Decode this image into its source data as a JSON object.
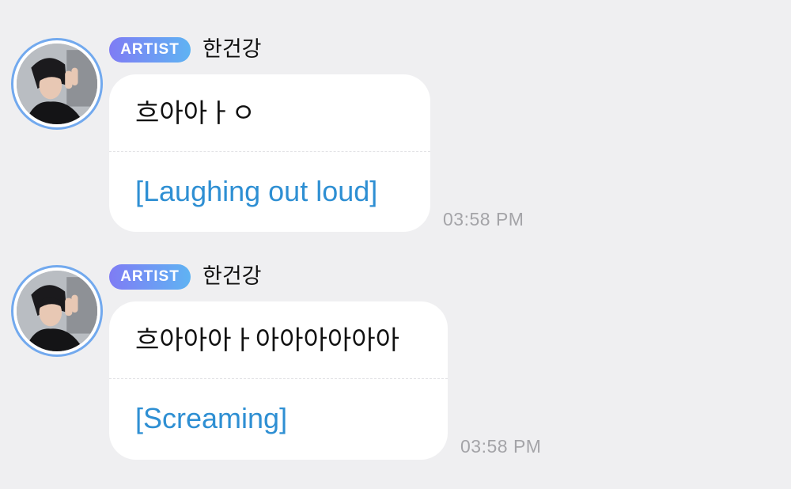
{
  "messages": [
    {
      "badge": "ARTIST",
      "sender": "한건강",
      "text": "흐아아ㅏㅇ",
      "translation": "[Laughing out loud]",
      "time": "03:58 PM",
      "avatar_icon": "artist-avatar-photo"
    },
    {
      "badge": "ARTIST",
      "sender": "한건강",
      "text": "흐아아아ㅏ아아아아아아",
      "translation": "[Screaming]",
      "time": "03:58 PM",
      "avatar_icon": "artist-avatar-photo"
    }
  ],
  "colors": {
    "background": "#efeff1",
    "badge_gradient_start": "#7f7cf4",
    "badge_gradient_end": "#5fb3f3",
    "avatar_ring": "#72a9ee",
    "translation_text": "#2e8fd3",
    "timestamp_text": "#a4a4a8"
  }
}
